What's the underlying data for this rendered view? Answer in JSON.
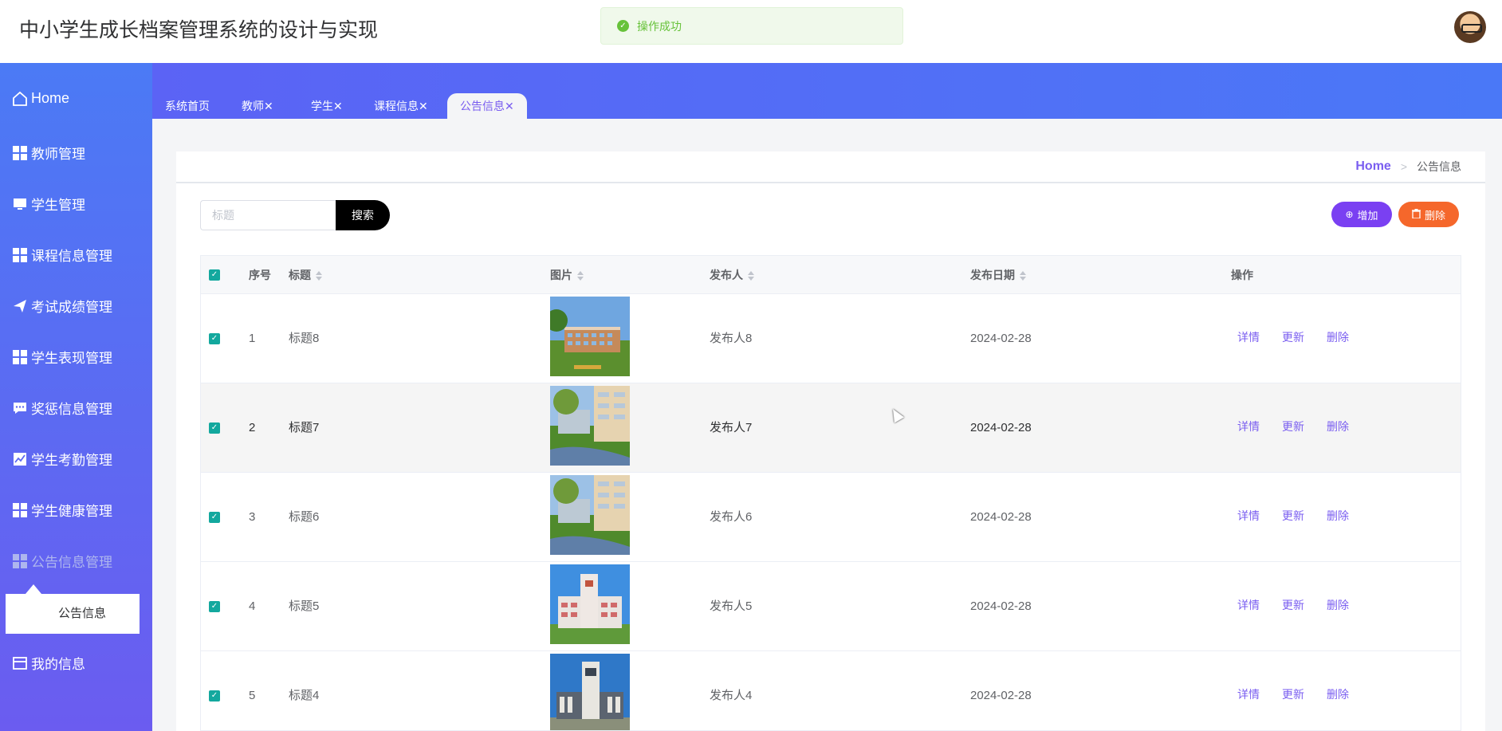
{
  "app": {
    "title": "中小学生成长档案管理系统的设计与实现"
  },
  "toast": {
    "message": "操作成功"
  },
  "sidebar": {
    "items": [
      {
        "label": "Home",
        "icon": "home-icon"
      },
      {
        "label": "教师管理",
        "icon": "grid-icon"
      },
      {
        "label": "学生管理",
        "icon": "monitor-icon"
      },
      {
        "label": "课程信息管理",
        "icon": "grid-icon"
      },
      {
        "label": "考试成绩管理",
        "icon": "send-icon"
      },
      {
        "label": "学生表现管理",
        "icon": "grid-icon"
      },
      {
        "label": "奖惩信息管理",
        "icon": "chat-icon"
      },
      {
        "label": "学生考勤管理",
        "icon": "chart-icon"
      },
      {
        "label": "学生健康管理",
        "icon": "grid-icon"
      },
      {
        "label": "公告信息管理",
        "icon": "grid-icon"
      },
      {
        "label": "我的信息",
        "icon": "card-icon"
      }
    ],
    "submenu": {
      "label": "公告信息"
    }
  },
  "tabs": [
    {
      "label": "系统首页",
      "closable": false
    },
    {
      "label": "教师",
      "closable": true
    },
    {
      "label": "学生",
      "closable": true
    },
    {
      "label": "课程信息",
      "closable": true
    },
    {
      "label": "公告信息",
      "closable": true,
      "active": true
    }
  ],
  "close_glyph": "✕",
  "breadcrumb": {
    "home": "Home",
    "separator": ">",
    "current": "公告信息"
  },
  "search": {
    "placeholder": "标题",
    "button": "搜索"
  },
  "actions": {
    "add": "增加",
    "delete": "删除"
  },
  "table": {
    "headers": {
      "index": "序号",
      "title": "标题",
      "image": "图片",
      "publisher": "发布人",
      "date": "发布日期",
      "ops": "操作"
    },
    "row_actions": {
      "detail": "详情",
      "update": "更新",
      "delete": "删除"
    },
    "rows": [
      {
        "index": "1",
        "title": "标题8",
        "publisher": "发布人8",
        "date": "2024-02-28",
        "checked": true
      },
      {
        "index": "2",
        "title": "标题7",
        "publisher": "发布人7",
        "date": "2024-02-28",
        "checked": true
      },
      {
        "index": "3",
        "title": "标题6",
        "publisher": "发布人6",
        "date": "2024-02-28",
        "checked": true
      },
      {
        "index": "4",
        "title": "标题5",
        "publisher": "发布人5",
        "date": "2024-02-28",
        "checked": true
      },
      {
        "index": "5",
        "title": "标题4",
        "publisher": "发布人4",
        "date": "2024-02-28",
        "checked": true
      }
    ]
  },
  "colors": {
    "accent": "#7a5ef0",
    "add_button": "#7a40f2",
    "delete_button": "#f5672b",
    "checkbox": "#13a89e",
    "success": "#67c23a"
  }
}
